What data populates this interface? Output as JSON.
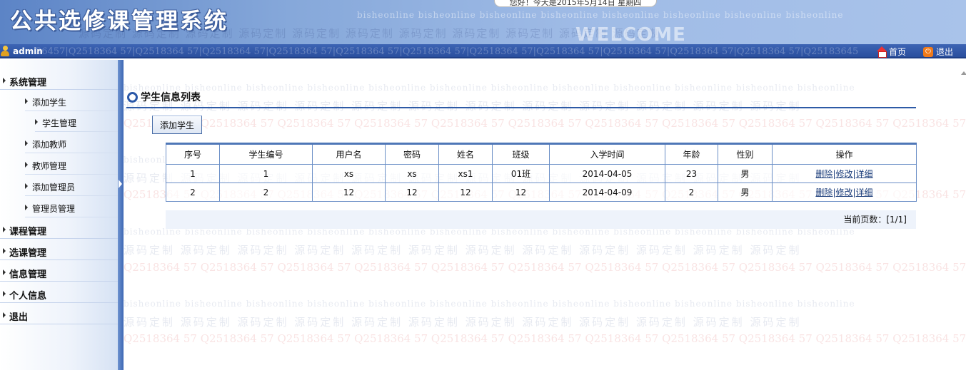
{
  "header": {
    "app_title": "公共选修课管理系统",
    "welcome_logo": "WELCOME",
    "notice": "您好！今天是2015年5月14日 星期四",
    "watermark_cn": "bisheonline  bisheonline  bisheonline  bisheonline  bisheonline  bisheonline  bisheonline  bisheonline",
    "watermark_cn2": "源码定制   源码定制   源码定制   源码定制   源码定制   源码定制   源码定制   源码定制   源码定制   源码定制   源码定制"
  },
  "userbar": {
    "username": "admin",
    "home_label": "首页",
    "logout_label": "退出",
    "watermark": "36457|Q2518364 57|Q2518364 57|Q2518364 57|Q2518364 57|Q2518364 57|Q2518364 57|Q2518364 57|Q2518364 57|Q2518364 57|Q2518364 57|Q2518364 57|Q25183645"
  },
  "sidebar": {
    "groups": [
      {
        "label": "系统管理"
      },
      {
        "label": "课程管理"
      },
      {
        "label": "选课管理"
      },
      {
        "label": "信息管理"
      },
      {
        "label": "个人信息"
      },
      {
        "label": "退出"
      }
    ],
    "system_items": [
      {
        "label": "添加学生"
      },
      {
        "label": "学生管理"
      },
      {
        "label": "添加教师"
      },
      {
        "label": "教师管理"
      },
      {
        "label": "添加管理员"
      },
      {
        "label": "管理员管理"
      }
    ]
  },
  "content": {
    "section_title": "学生信息列表",
    "add_button_label": "添加学生",
    "table": {
      "headers": [
        "序号",
        "学生编号",
        "用户名",
        "密码",
        "姓名",
        "班级",
        "入学时间",
        "年龄",
        "性别",
        "操作"
      ],
      "rows": [
        [
          "1",
          "1",
          "xs",
          "xs",
          "xs1",
          "01班",
          "2014-04-05",
          "23",
          "男"
        ],
        [
          "2",
          "2",
          "12",
          "12",
          "12",
          "12",
          "2014-04-09",
          "2",
          "男"
        ]
      ],
      "actions": {
        "delete": "删除",
        "edit": "修改",
        "detail": "详细",
        "separator": "|"
      }
    },
    "pager_text": "当前页数：[1/1]",
    "watermark_a": "bisheonline  bisheonline  bisheonline  bisheonline  bisheonline  bisheonline  bisheonline  bisheonline  bisheonline  bisheonline  bisheonline  bisheonline",
    "watermark_b": "源码定制   源码定制   源码定制   源码定制   源码定制   源码定制   源码定制   源码定制   源码定制   源码定制   源码定制   源码定制",
    "watermark_c": "Q2518364 57 Q2518364 57 Q2518364 57 Q2518364 57 Q2518364 57 Q2518364 57 Q2518364 57 Q2518364 57 Q2518364 57 Q2518364 57 Q2518364 57 Q2518364 57"
  }
}
